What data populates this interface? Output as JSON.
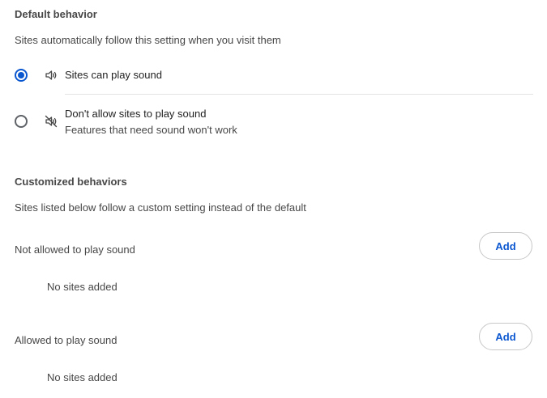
{
  "default_behavior": {
    "title": "Default behavior",
    "description": "Sites automatically follow this setting when you visit them",
    "options": [
      {
        "label": "Sites can play sound",
        "sublabel": "",
        "icon": "volume-icon",
        "selected": true
      },
      {
        "label": "Don't allow sites to play sound",
        "sublabel": "Features that need sound won't work",
        "icon": "volume-off-icon",
        "selected": false
      }
    ]
  },
  "customized_behaviors": {
    "title": "Customized behaviors",
    "description": "Sites listed below follow a custom setting instead of the default",
    "lists": [
      {
        "label": "Not allowed to play sound",
        "add_label": "Add",
        "empty_text": "No sites added"
      },
      {
        "label": "Allowed to play sound",
        "add_label": "Add",
        "empty_text": "No sites added"
      }
    ]
  },
  "colors": {
    "accent": "#0b57d0",
    "text_primary": "#1f1f1f",
    "text_secondary": "#474747",
    "divider": "#e3e3e3"
  }
}
